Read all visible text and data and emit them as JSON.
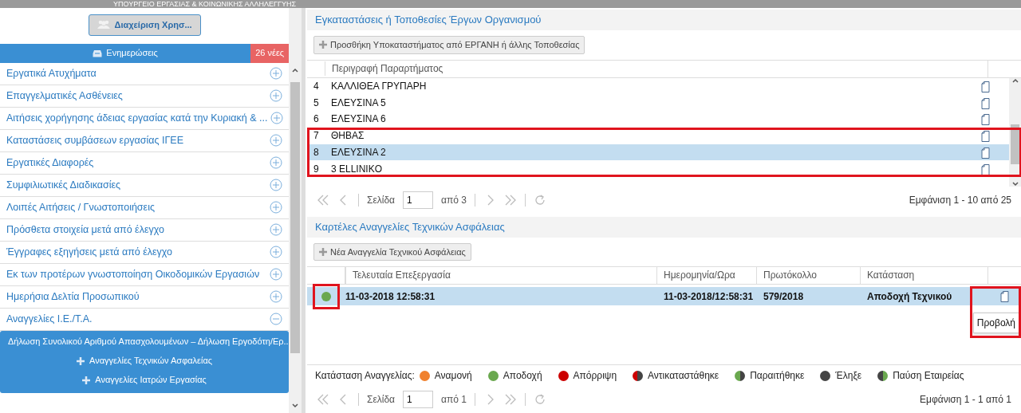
{
  "header": {
    "ministry": "ΥΠΟΥΡΓΕΙΟ ΕΡΓΑΣΙΑΣ  &  ΚΟΙΝΩΝΙΚΗΣ ΑΛΛΗΛΕΓΓΥΗΣ"
  },
  "sidebar": {
    "user_button": "Διαχείριση Χρησ...",
    "notifications": {
      "label": "Ενημερώσεις",
      "badge": "26 νέες"
    },
    "items": [
      {
        "label": "Εργατικά Ατυχήματα",
        "expanded": false
      },
      {
        "label": "Επαγγελματικές Ασθένειες",
        "expanded": false
      },
      {
        "label": "Αιτήσεις χορήγησης άδειας εργασίας κατά την Κυριακή & ...",
        "expanded": false
      },
      {
        "label": "Καταστάσεις συμβάσεων εργασίας ΙΓΕΕ",
        "expanded": false
      },
      {
        "label": "Εργατικές Διαφορές",
        "expanded": false
      },
      {
        "label": "Συμφιλιωτικές Διαδικασίες",
        "expanded": false
      },
      {
        "label": "Λοιπές Αιτήσεις / Γνωστοποιήσεις",
        "expanded": false
      },
      {
        "label": "Πρόσθετα στοιχεία μετά από έλεγχο",
        "expanded": false
      },
      {
        "label": "Έγγραφες εξηγήσεις μετά από έλεγχο",
        "expanded": false
      },
      {
        "label": "Εκ των προτέρων γνωστοποίηση Οικοδομικών Εργασιών",
        "expanded": false
      },
      {
        "label": "Ημερήσια Δελτία Προσωπικού",
        "expanded": false
      },
      {
        "label": "Αναγγελίες Ι.Ε./Τ.Α.",
        "expanded": true,
        "children": [
          {
            "label": "Δήλωση Συνολικού Αριθμού Απασχολουμένων – Δήλωση Εργοδότη/Ερ...",
            "kind": "link"
          },
          {
            "label": "Αναγγελίες Τεχνικών Ασφαλείας",
            "kind": "add"
          },
          {
            "label": "Αναγγελίες Ιατρών Εργασίας",
            "kind": "add"
          }
        ]
      }
    ]
  },
  "locations": {
    "title": "Εγκαταστάσεις ή Τοποθεσίες Έργων Οργανισμού",
    "add_button": "Προσθήκη Υποκαταστήματος από ΕΡΓΑΝΗ ή άλλης Τοποθεσίας",
    "columns": [
      "Περιγραφή Παραρτήματος"
    ],
    "rows": [
      {
        "num": "4",
        "name": "ΚΑΛΛΙΘΕΑ ΓΡΥΠΑΡΗ",
        "selected": false
      },
      {
        "num": "5",
        "name": "ΕΛΕΥΣΙΝΑ 5",
        "selected": false
      },
      {
        "num": "6",
        "name": "ΕΛΕΥΣΙΝΑ 6",
        "selected": false
      },
      {
        "num": "7",
        "name": "ΘΗΒΑΣ",
        "selected": false
      },
      {
        "num": "8",
        "name": "ΕΛΕΥΣΙΝΑ 2",
        "selected": true
      },
      {
        "num": "9",
        "name": "3 ELLINIKO",
        "selected": false
      }
    ],
    "pager": {
      "page_label": "Σελίδα",
      "page": "1",
      "of": "από 3",
      "summary": "Εμφάνιση 1 - 10 από 25"
    }
  },
  "safety": {
    "title": "Καρτέλες Αναγγελίες Τεχνικών Ασφάλειας",
    "add_button": "Νέα Αναγγελία Τεχνικού Ασφάλειας",
    "columns": [
      "Τελευταία Επεξεργασία",
      "Ημερομηνία/Ωρα",
      "Πρωτόκολλο",
      "Κατάσταση"
    ],
    "rows": [
      {
        "color": "#6aa84f",
        "cells": [
          "11-03-2018 12:58:31",
          "11-03-2018/12:58:31",
          "579/2018",
          "Αποδοχή Τεχνικού"
        ],
        "selected": true
      }
    ],
    "tooltip": "Προβολή",
    "legend": {
      "label": "Κατάσταση Αναγγελίας:",
      "items": [
        {
          "label": "Αναμονή",
          "kind": "solid",
          "color": "#f0812e"
        },
        {
          "label": "Αποδοχή",
          "kind": "solid",
          "color": "#6aa84f"
        },
        {
          "label": "Απόρριψη",
          "kind": "solid",
          "color": "#cc0000"
        },
        {
          "label": "Αντικαταστάθηκε",
          "kind": "halfdark",
          "color": "#cc0000"
        },
        {
          "label": "Παραιτήθηκε",
          "kind": "halfdark",
          "color": "#6aa84f"
        },
        {
          "label": "Έληξε",
          "kind": "solid",
          "color": "#444444"
        },
        {
          "label": "Παύση Εταιρείας",
          "kind": "darkhalf",
          "color": "#6aa84f"
        }
      ]
    },
    "pager": {
      "page_label": "Σελίδα",
      "page": "1",
      "of": "από 1",
      "summary": "Εμφάνιση 1 - 1 από 1"
    }
  }
}
